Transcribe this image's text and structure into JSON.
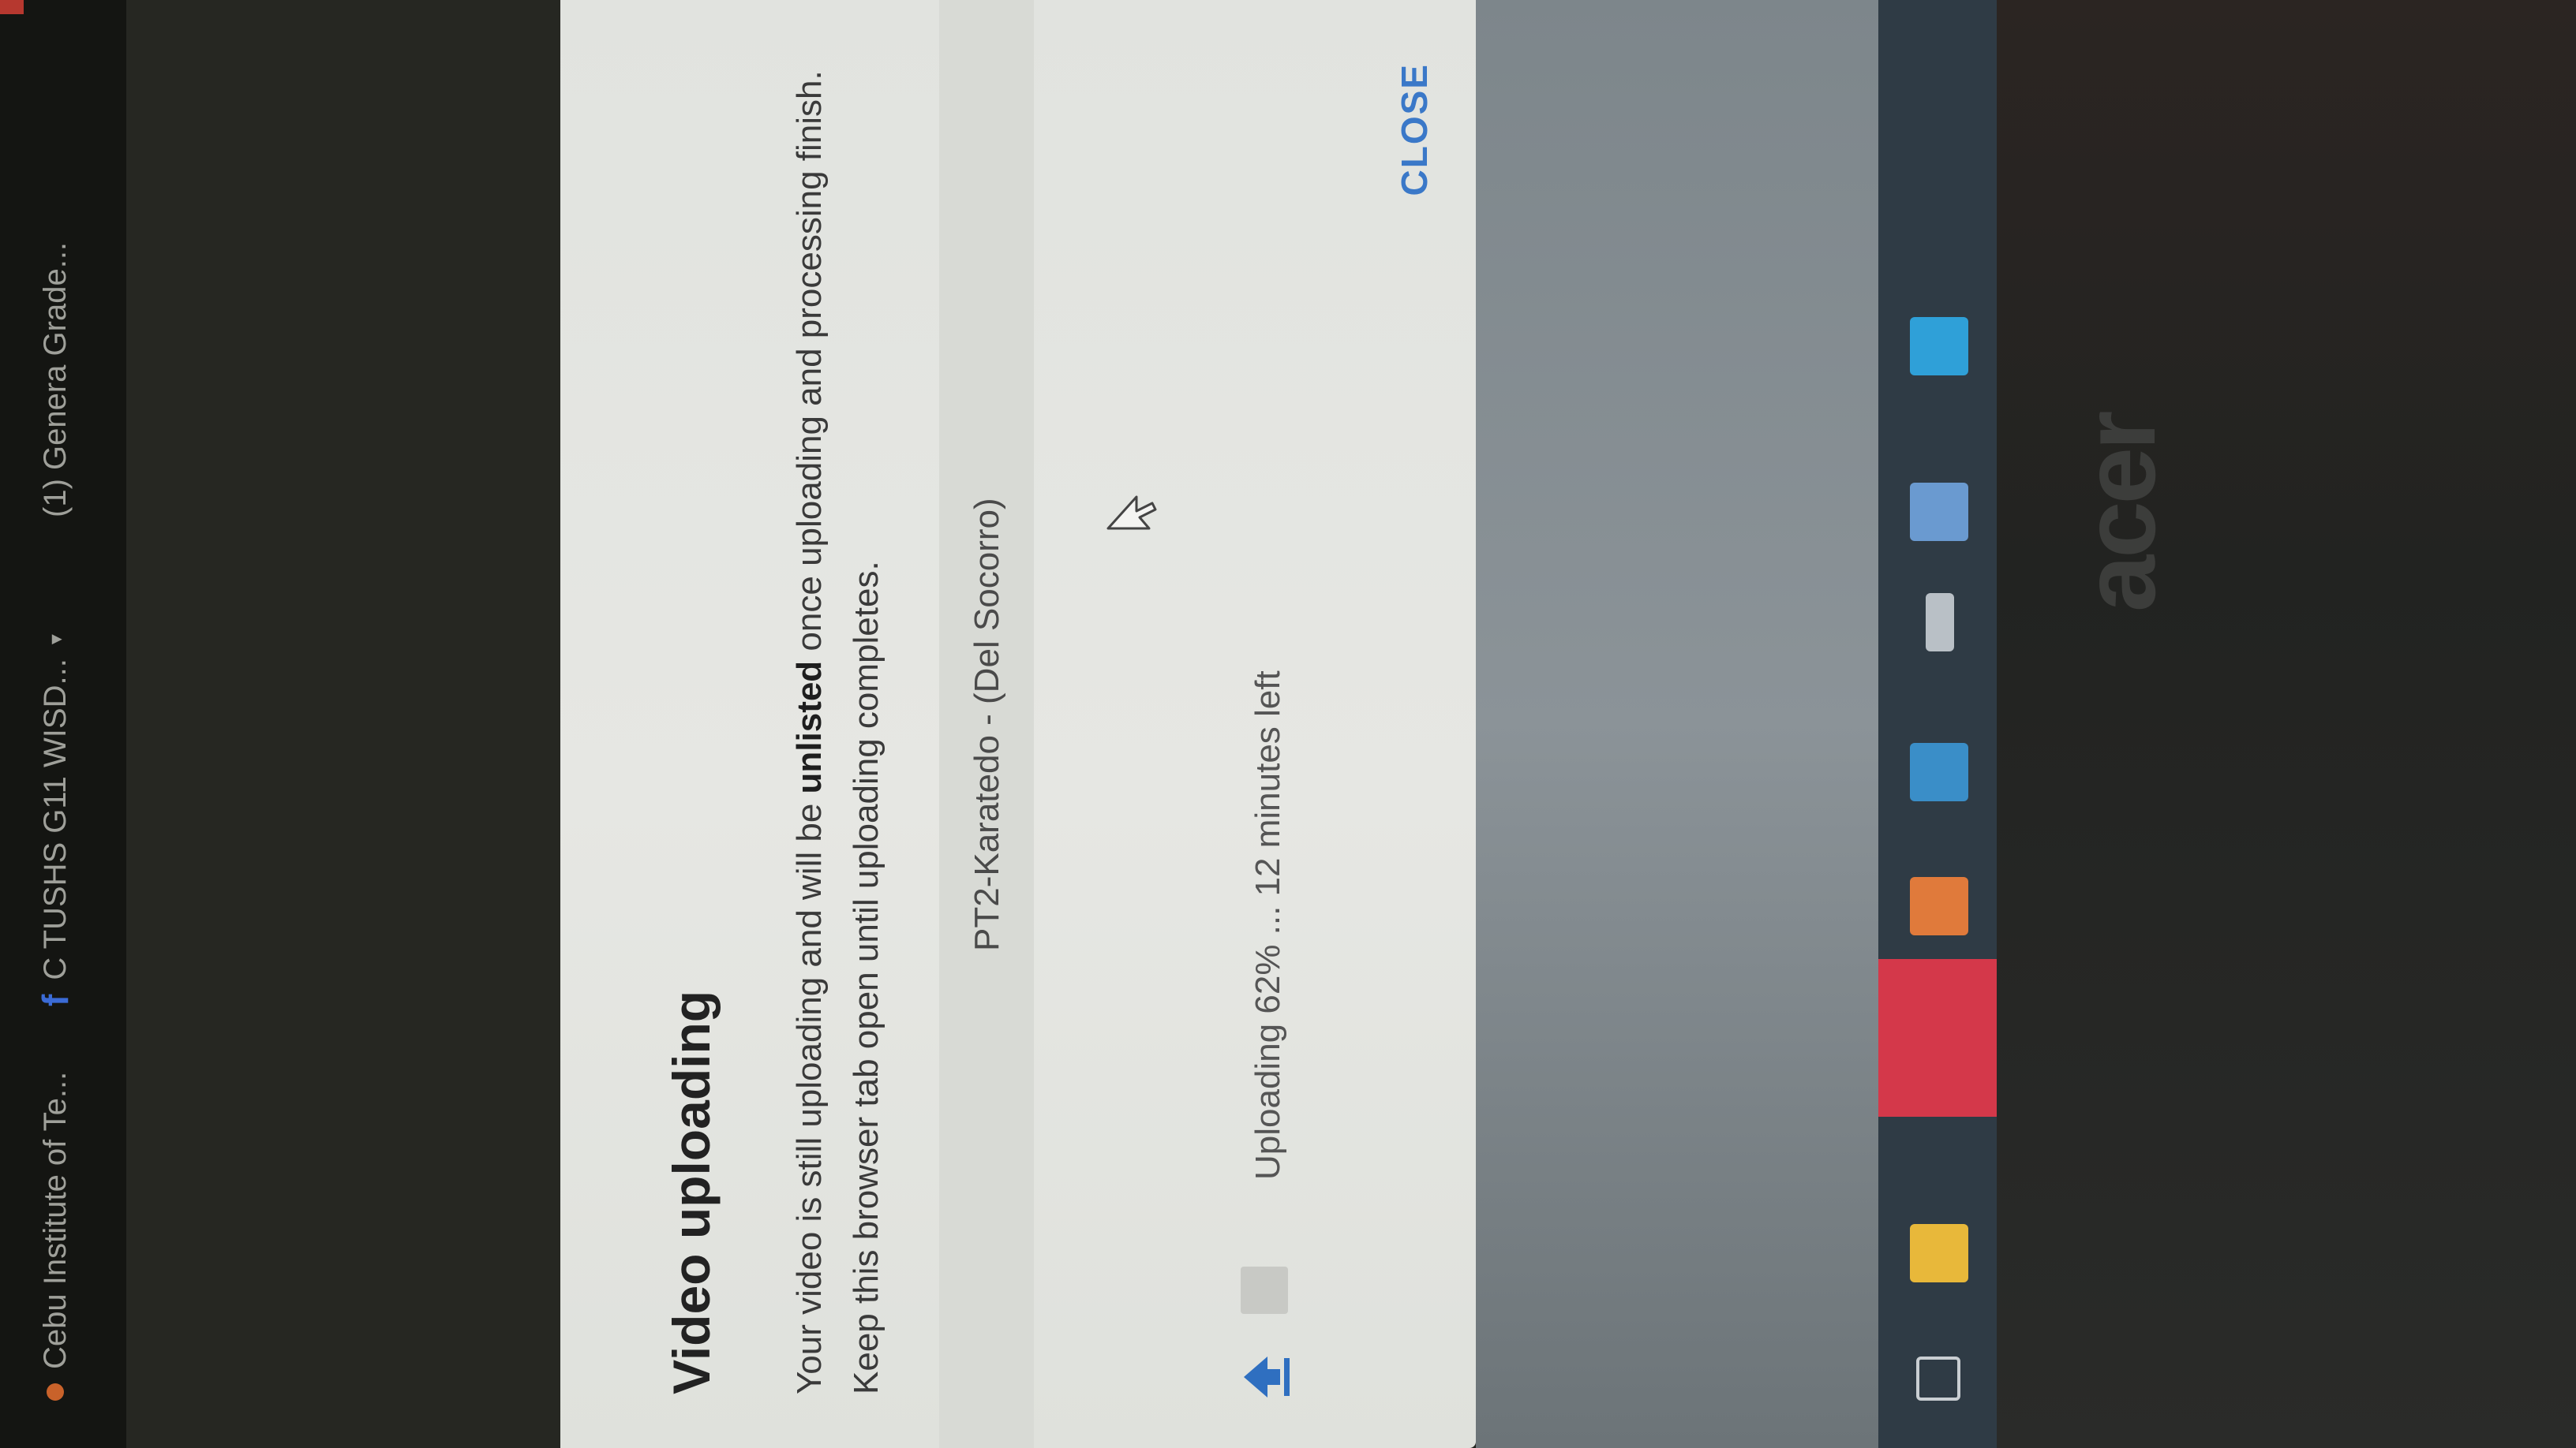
{
  "tabs": [
    {
      "label": "Cebu Institute of Te..."
    },
    {
      "label": "C TUSHS G11 WISD..."
    },
    {
      "label": "(1) Genera   Grade..."
    }
  ],
  "dialog": {
    "title": "Video uploading",
    "message_part1": "Your video is still uploading and will be ",
    "message_bold": "unlisted",
    "message_part2": " once uploading and processing finish. Keep this browser tab open until uploading completes.",
    "file_name": "PT2-Karatedo - (Del Socorro)",
    "upload_status": "Uploading 62% ... 12 minutes left",
    "upload_progress_percent": 62,
    "close_label": "CLOSE"
  },
  "monitor": {
    "brand": "acer"
  },
  "colors": {
    "accent": "#3a78c8",
    "upload_icon": "#2f6fc0"
  }
}
